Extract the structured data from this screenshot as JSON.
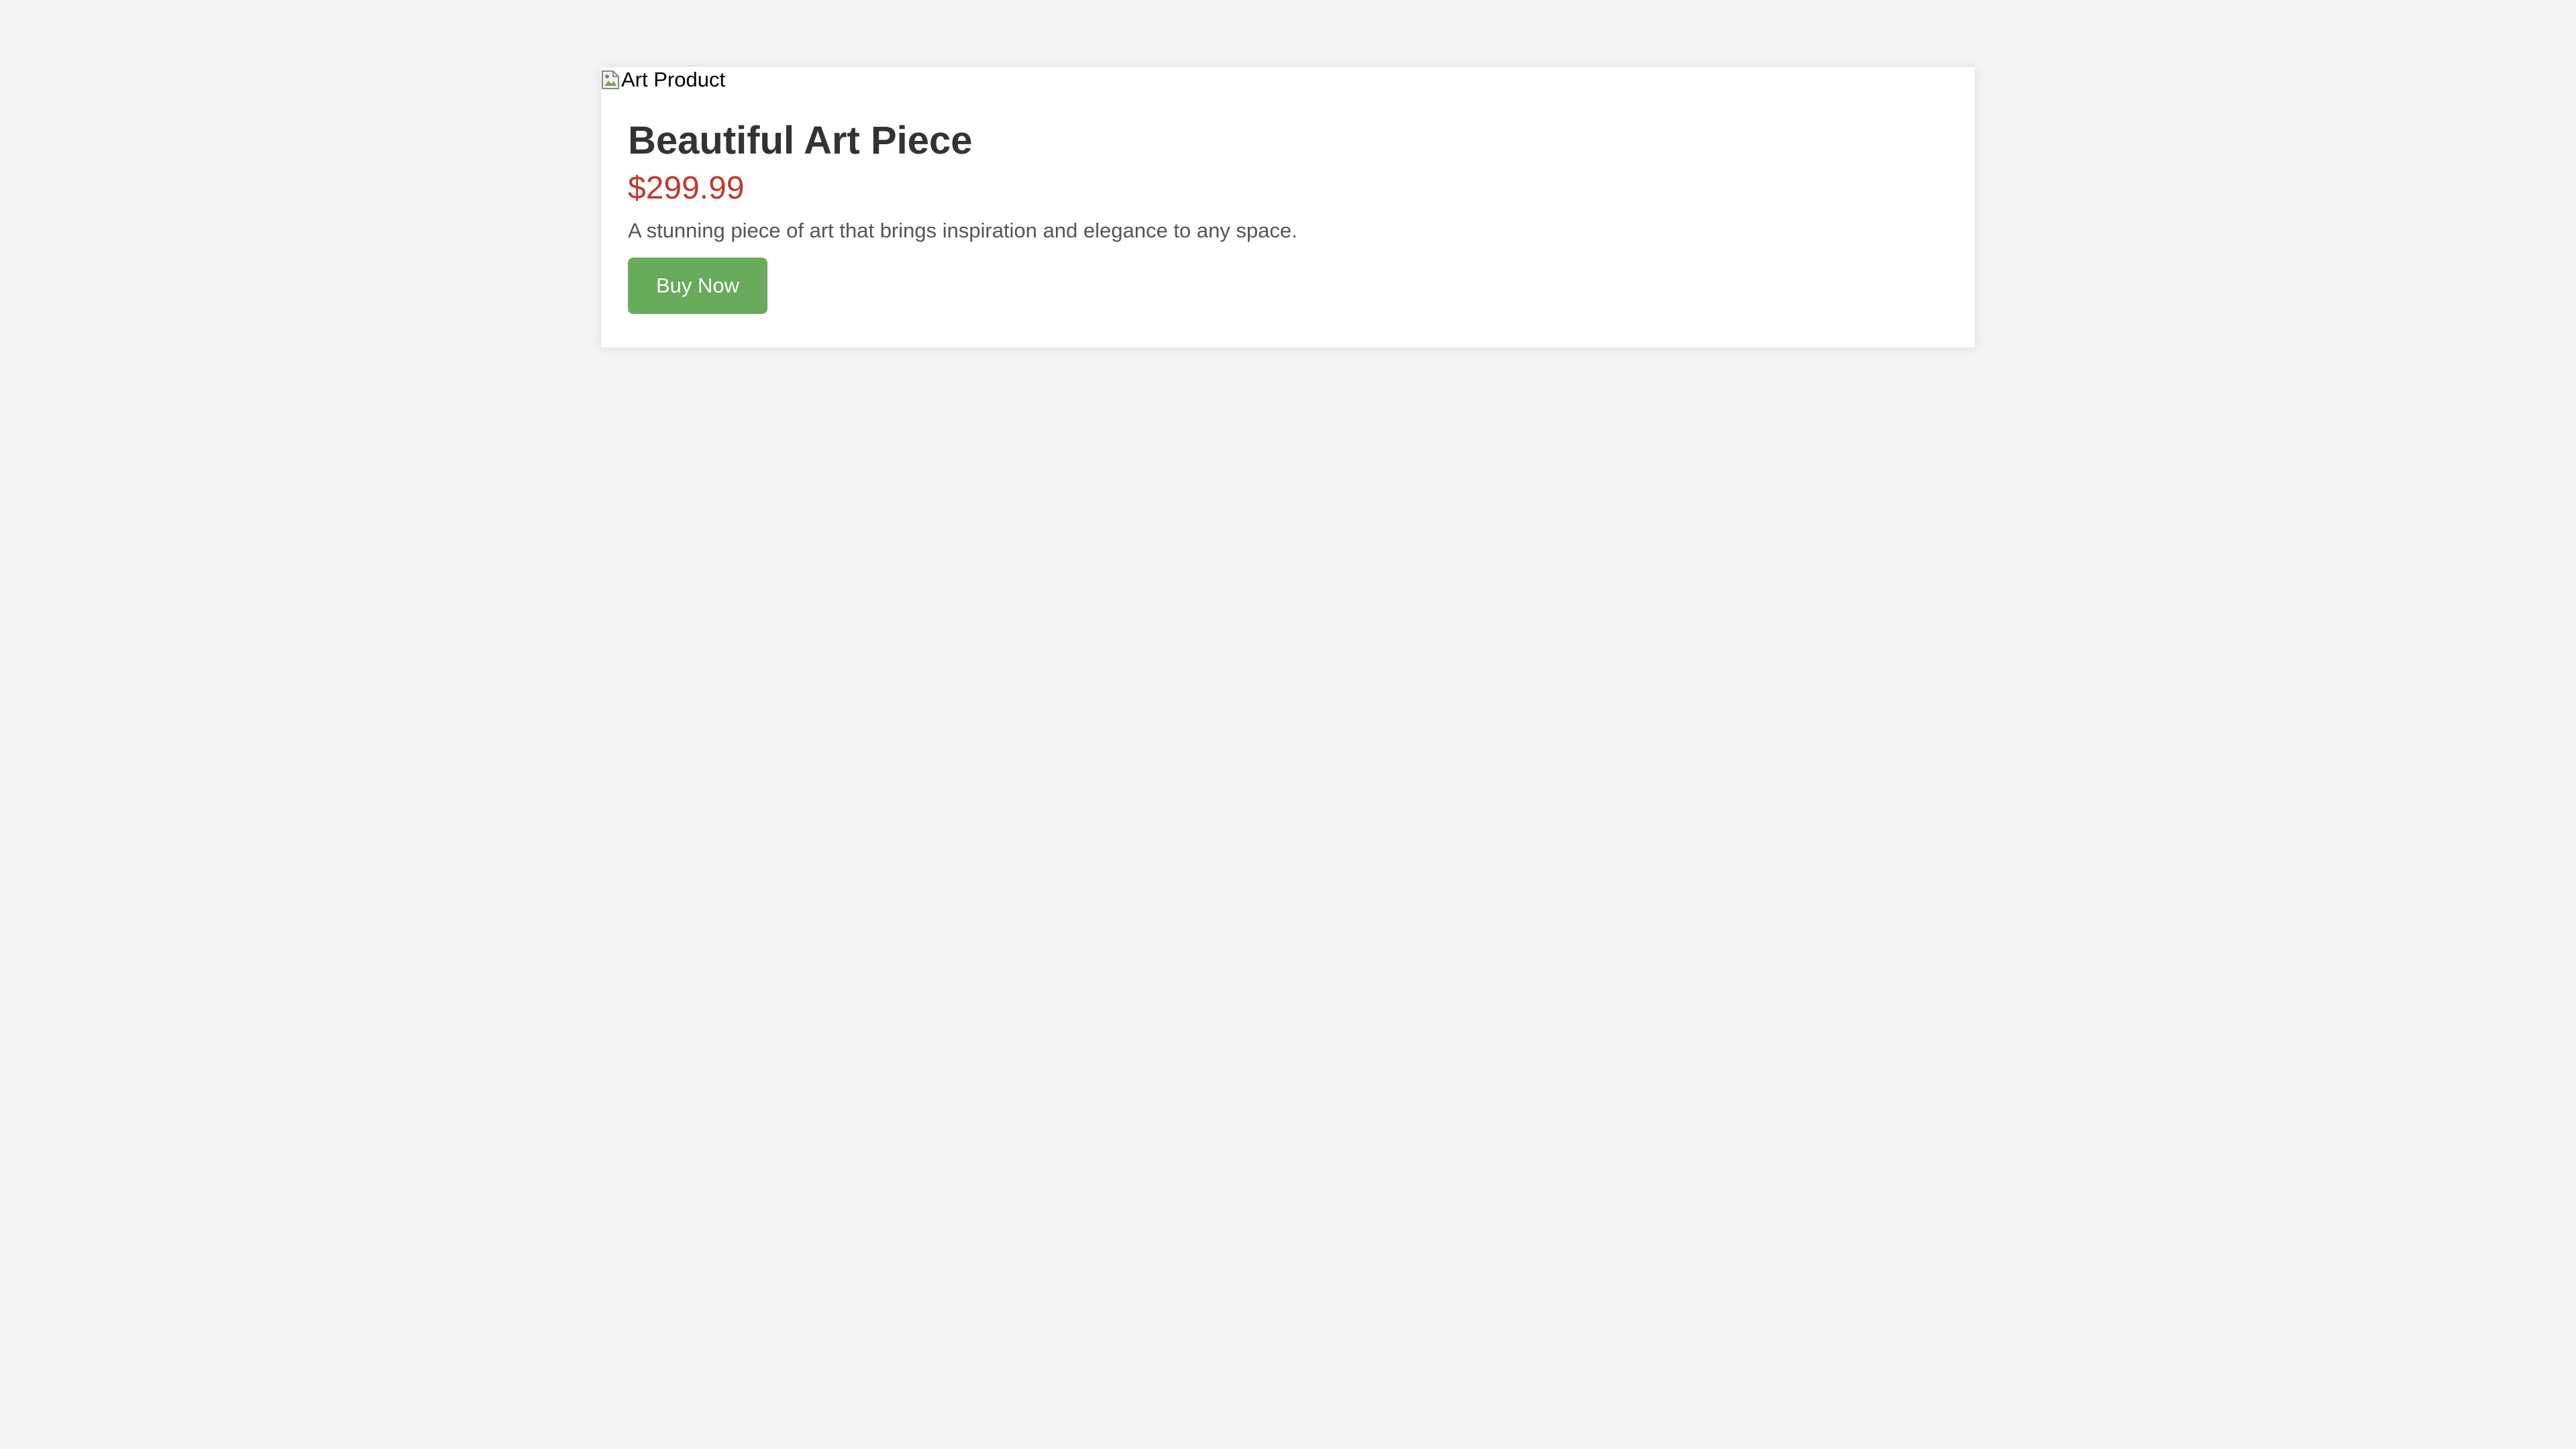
{
  "product": {
    "image_alt": "Art Product",
    "image_icon": "broken-image-icon",
    "title": "Beautiful Art Piece",
    "price": "$299.99",
    "description": "A stunning piece of art that brings inspiration and elegance to any space.",
    "buy_label": "Buy Now"
  },
  "colors": {
    "background": "#f4f4f4",
    "card": "#ffffff",
    "title": "#333333",
    "price": "#c0392b",
    "description": "#555555",
    "button": "#67ab5b",
    "button_text": "#ffffff"
  }
}
